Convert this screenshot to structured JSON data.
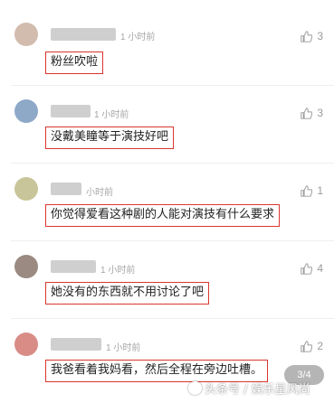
{
  "comments": [
    {
      "time": "1 小时前",
      "likes": "3",
      "text": "粉丝吹啦"
    },
    {
      "time": "1 小时前",
      "likes": "3",
      "text": "没戴美瞳等于演技好吧"
    },
    {
      "time": "小时前",
      "likes": "1",
      "text": "你觉得爱看这种剧的人能对演技有什么要求"
    },
    {
      "time": "1 小时前",
      "likes": "4",
      "text": "她没有的东西就不用讨论了吧"
    },
    {
      "time": "1 小时前",
      "likes": "2",
      "text": "我爸看着我妈看，然后全程在旁边吐槽。"
    }
  ],
  "pager": "3/4",
  "watermark": "头条号 / 娱乐星风尚",
  "colors": {
    "highlight_border": "#d9362f",
    "meta_text": "#a6a6a6"
  },
  "icons": {
    "like": "thumbs-up-icon"
  }
}
